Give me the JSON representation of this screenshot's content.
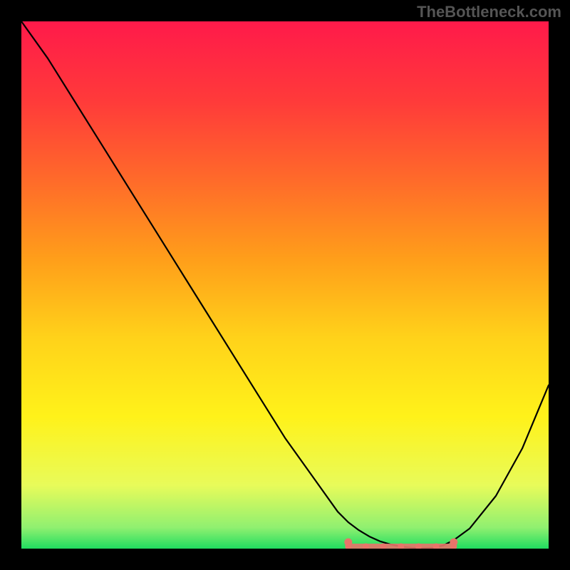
{
  "watermark": "TheBottleneck.com",
  "chart_data": {
    "type": "line",
    "title": "",
    "xlabel": "",
    "ylabel": "",
    "xlim": [
      0,
      100
    ],
    "ylim": [
      0,
      100
    ],
    "x": [
      0,
      5,
      10,
      15,
      20,
      25,
      30,
      35,
      40,
      45,
      50,
      55,
      60,
      62,
      64,
      66,
      68,
      70,
      72,
      74,
      76,
      78,
      80,
      82,
      85,
      90,
      95,
      100
    ],
    "values": [
      100,
      93,
      85,
      77,
      69,
      61,
      53,
      45,
      37,
      29,
      21,
      14,
      7,
      5,
      3.5,
      2.3,
      1.4,
      0.8,
      0.4,
      0.15,
      0.05,
      0.15,
      0.6,
      1.6,
      3.8,
      10,
      19,
      31
    ],
    "minimum_band": {
      "x_start": 62,
      "x_end": 82,
      "y_threshold": 6
    },
    "gradient_stops": [
      {
        "offset": 0.0,
        "color": "#ff1a4a"
      },
      {
        "offset": 0.15,
        "color": "#ff3a3a"
      },
      {
        "offset": 0.3,
        "color": "#ff6a2a"
      },
      {
        "offset": 0.45,
        "color": "#ff9e1a"
      },
      {
        "offset": 0.6,
        "color": "#ffd21a"
      },
      {
        "offset": 0.75,
        "color": "#fff21a"
      },
      {
        "offset": 0.88,
        "color": "#e8fb5a"
      },
      {
        "offset": 0.96,
        "color": "#90f070"
      },
      {
        "offset": 1.0,
        "color": "#20dd60"
      }
    ]
  }
}
